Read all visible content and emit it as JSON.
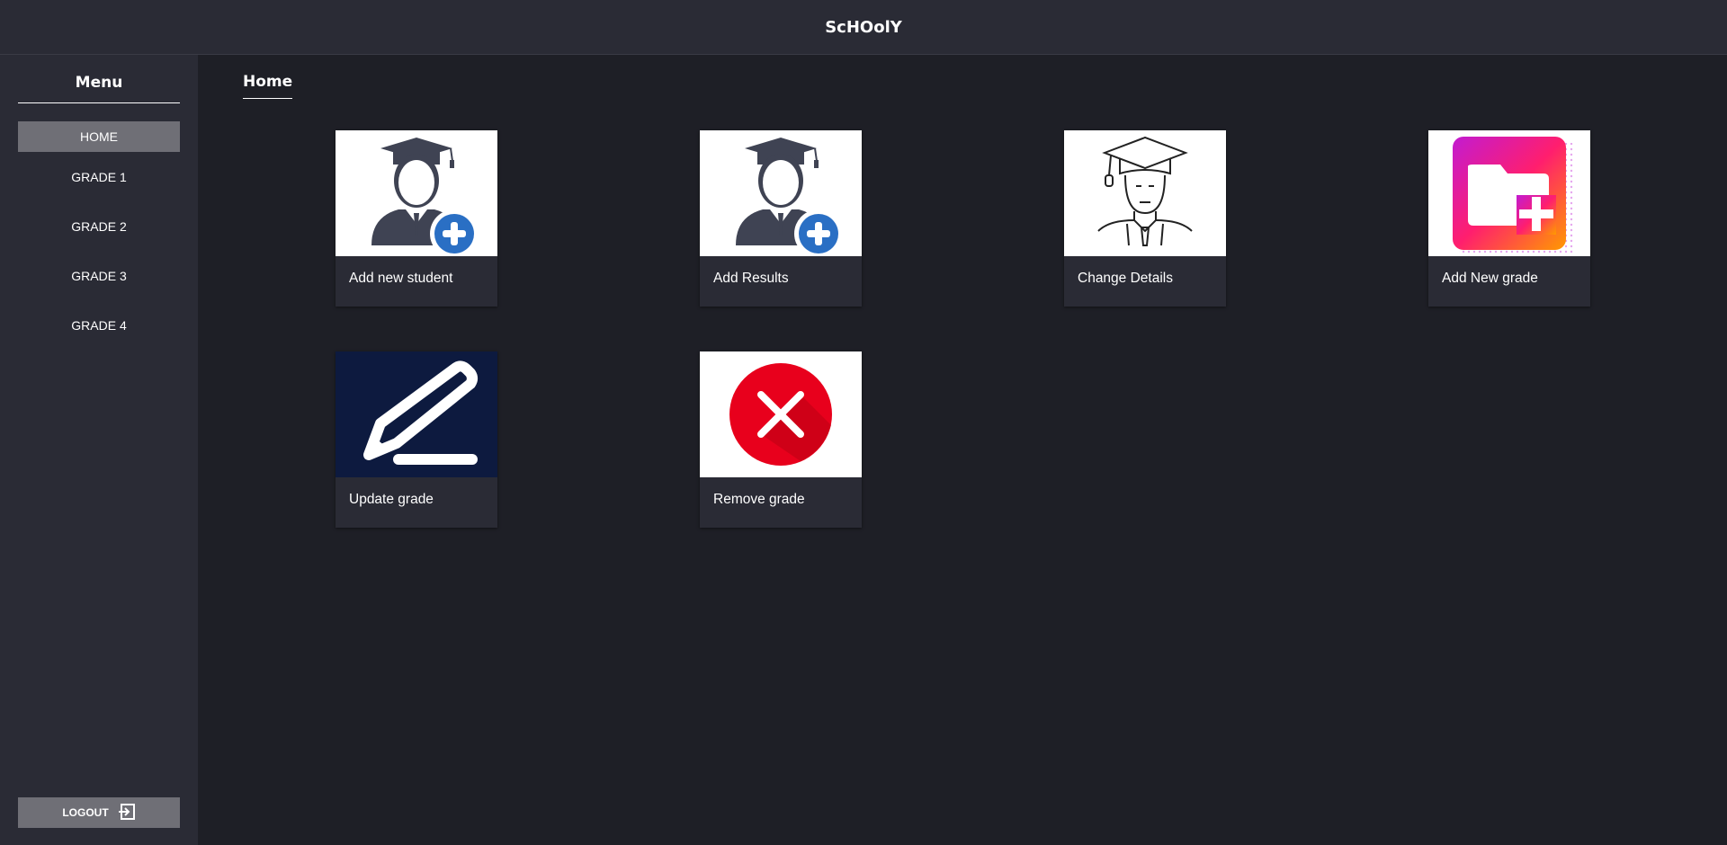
{
  "app": {
    "title": "ScHOolY"
  },
  "sidebar": {
    "title": "Menu",
    "items": [
      {
        "label": "HOME",
        "active": true
      },
      {
        "label": "GRADE 1",
        "active": false
      },
      {
        "label": "GRADE 2",
        "active": false
      },
      {
        "label": "GRADE 3",
        "active": false
      },
      {
        "label": "GRADE 4",
        "active": false
      }
    ],
    "logout_label": "LOGOUT"
  },
  "main": {
    "title": "Home",
    "cards": [
      {
        "label": "Add new student",
        "icon": "student-add-icon"
      },
      {
        "label": "Add Results",
        "icon": "student-add-icon"
      },
      {
        "label": "Change Details",
        "icon": "graduate-icon"
      },
      {
        "label": "Add New grade",
        "icon": "folder-add-icon"
      },
      {
        "label": "Update grade",
        "icon": "pencil-icon"
      },
      {
        "label": "Remove grade",
        "icon": "remove-icon"
      }
    ]
  },
  "colors": {
    "background": "#1e1f26",
    "panel": "#2a2b35",
    "active_nav": "#6f6f76",
    "accent_blue": "#2a6fc4",
    "danger_red": "#e8001c"
  }
}
